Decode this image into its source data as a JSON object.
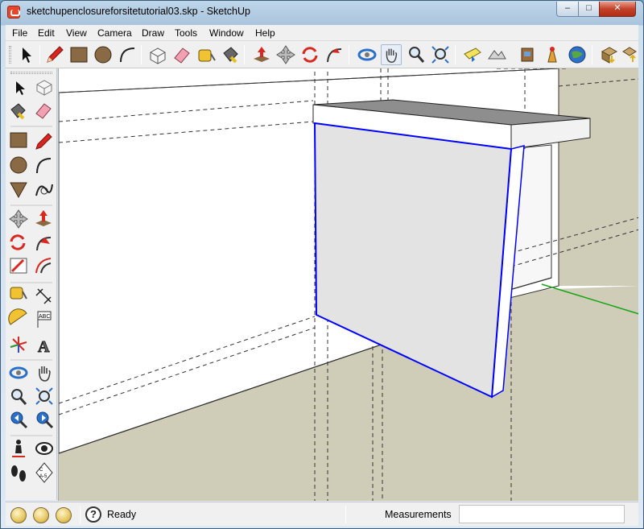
{
  "window": {
    "title": "sketchupenclosureforsitetutorial03.skp - SketchUp",
    "minimize": "–",
    "maximize": "□",
    "close": "✕"
  },
  "menu": [
    "File",
    "Edit",
    "View",
    "Camera",
    "Draw",
    "Tools",
    "Window",
    "Help"
  ],
  "toolbar_top": [
    "select-tool-icon",
    "pencil-line-icon",
    "rectangle-icon",
    "circle-icon",
    "arc-icon",
    "make-component-icon",
    "eraser-icon",
    "tape-measure-icon",
    "paint-bucket-icon",
    "push-pull-icon",
    "move-icon",
    "rotate-icon",
    "follow-me-icon",
    "orbit-icon",
    "pan-icon",
    "zoom-icon",
    "zoom-extents-icon",
    "add-location-icon",
    "toggle-terrain-icon",
    "get-models-icon",
    "share-model-icon",
    "google-earth-icon",
    "get-components-icon",
    "share-component-icon"
  ],
  "toolbar_left": [
    "select-icon",
    "make-component-icon",
    "paint-bucket-icon",
    "eraser-icon",
    "rectangle-icon",
    "line-icon",
    "circle-icon",
    "arc-icon",
    "polygon-icon",
    "freehand-icon",
    "move-icon",
    "push-pull-icon",
    "rotate-icon",
    "follow-me-icon",
    "scale-icon",
    "offset-icon",
    "tape-measure-icon",
    "dimension-icon",
    "protractor-icon",
    "text-icon",
    "axes-icon",
    "3d-text-icon",
    "orbit-icon",
    "pan-icon",
    "zoom-icon",
    "zoom-window-icon",
    "previous-view-icon",
    "next-view-icon",
    "position-camera-icon",
    "look-around-icon",
    "walk-icon",
    "section-plane-icon"
  ],
  "status": {
    "text": "Ready",
    "measurements_label": "Measurements",
    "measurements_value": "",
    "help_glyph": "?"
  },
  "colors": {
    "selection_edge": "#0000ff",
    "ground": "#cfcdb8",
    "wall_face": "#ffffff",
    "panel_face": "#e3e3e3",
    "top_face": "#8e8e8e",
    "green_axis": "#16a316"
  }
}
